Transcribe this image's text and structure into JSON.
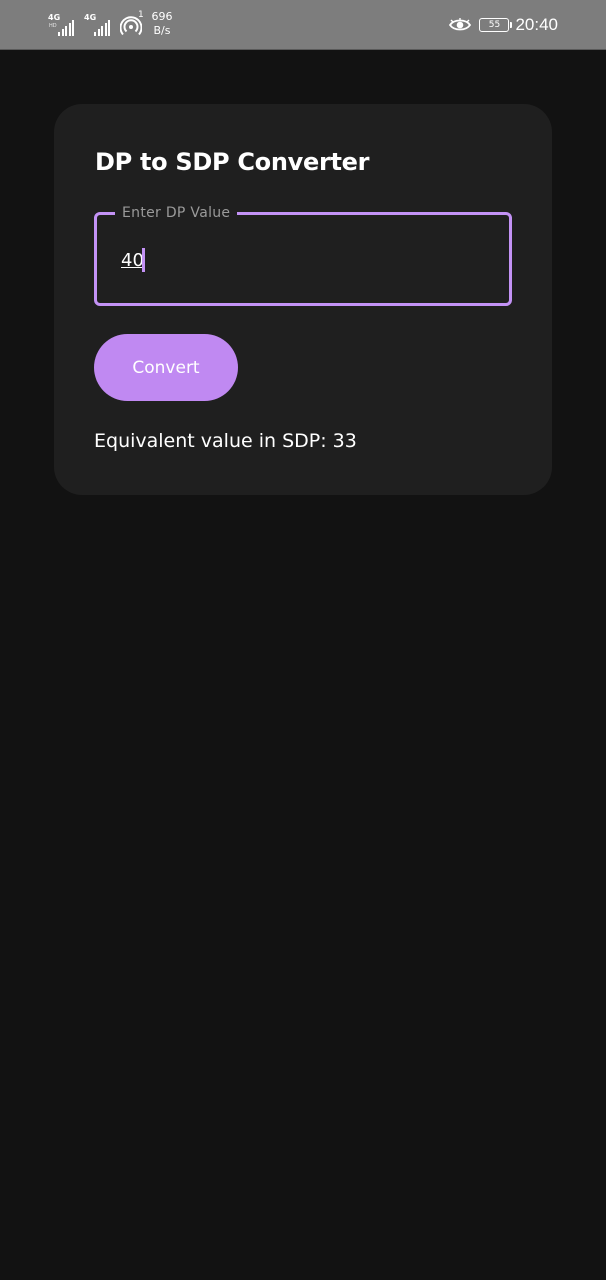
{
  "status_bar": {
    "sim1_network": "4G",
    "sim2_network": "4G",
    "hotspot_clients": "1",
    "speed_value": "696",
    "speed_unit": "B/s",
    "battery": "55",
    "time": "20:40",
    "icons": [
      "signal-icon",
      "signal-icon",
      "hotspot-icon",
      "eye-icon",
      "battery-icon"
    ]
  },
  "card": {
    "title": "DP to SDP Converter",
    "input": {
      "label": "Enter DP Value",
      "value": "40"
    },
    "convert_label": "Convert",
    "result_text": "Equivalent value in SDP: 33"
  },
  "colors": {
    "background": "#121212",
    "card": "#1f1f1f",
    "accent": "#c392f5",
    "button": "#c089f2",
    "status_bar": "#7d7d7d"
  }
}
